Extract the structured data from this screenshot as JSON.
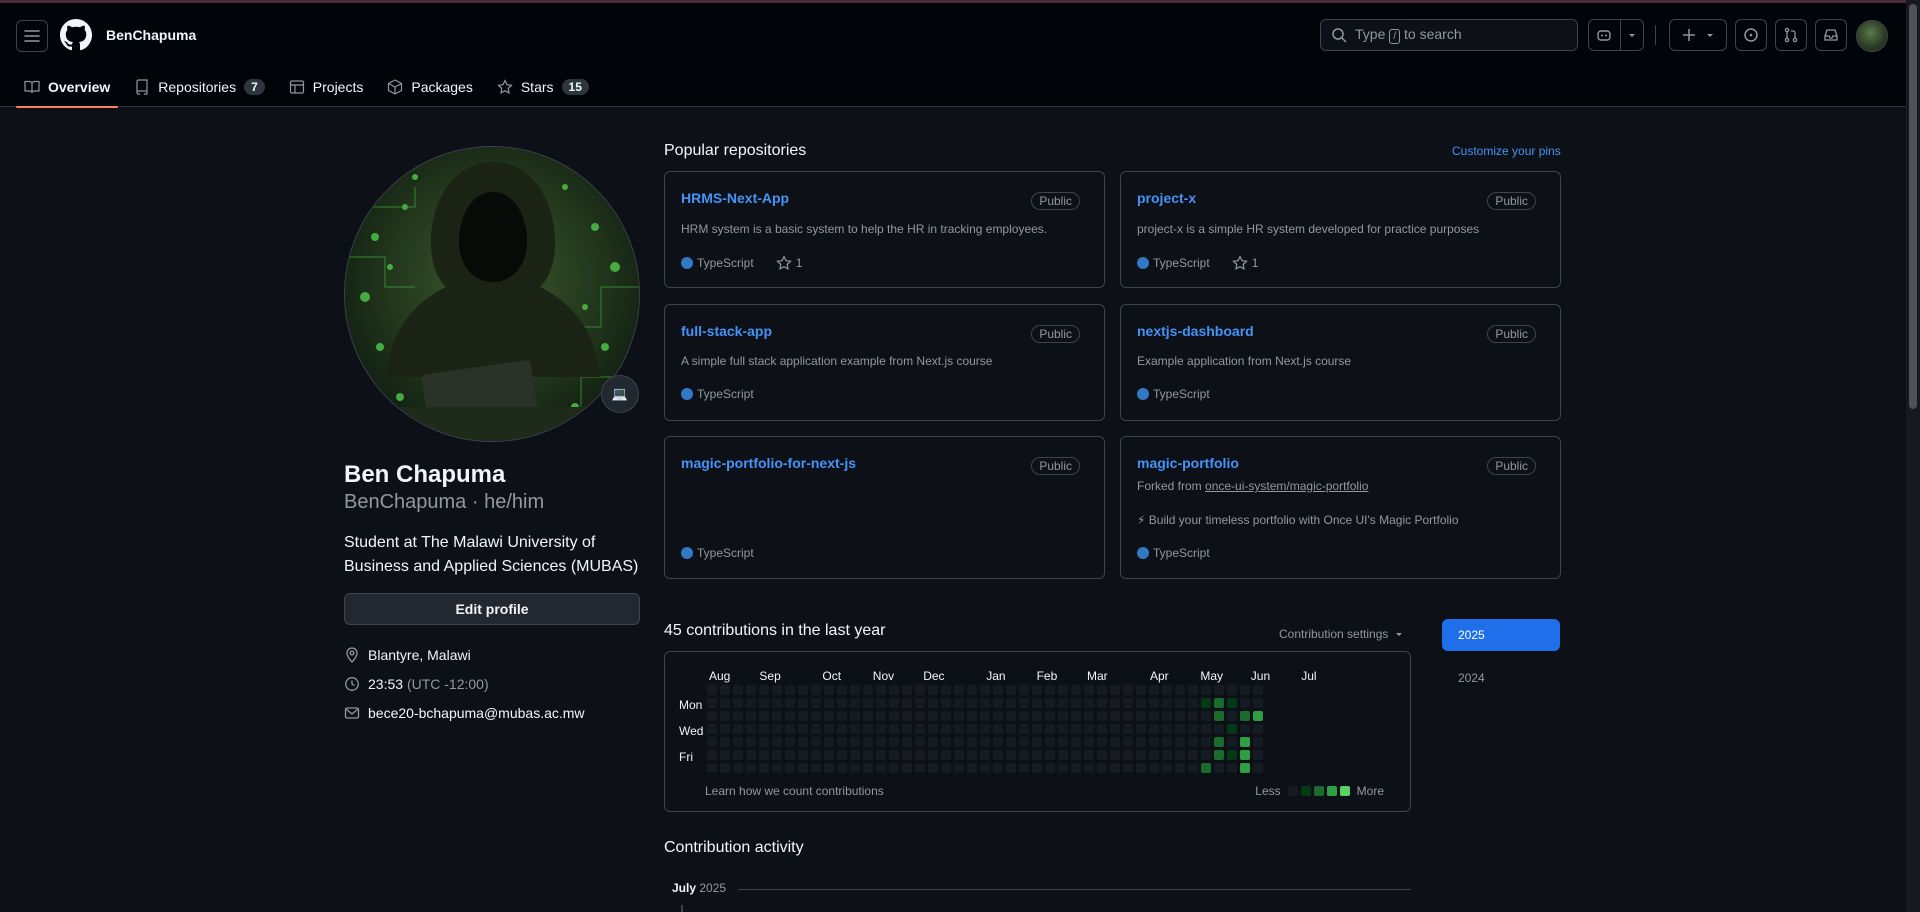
{
  "header": {
    "username": "BenChapuma",
    "search_placeholder_prefix": "Type",
    "search_key": "/",
    "search_placeholder_suffix": "to search"
  },
  "tabs": [
    {
      "label": "Overview",
      "count": null,
      "icon": "book-icon"
    },
    {
      "label": "Repositories",
      "count": "7",
      "icon": "repo-icon"
    },
    {
      "label": "Projects",
      "count": null,
      "icon": "table-icon"
    },
    {
      "label": "Packages",
      "count": null,
      "icon": "package-icon"
    },
    {
      "label": "Stars",
      "count": "15",
      "icon": "star-icon"
    }
  ],
  "profile": {
    "name": "Ben Chapuma",
    "login_line": "BenChapuma · he/him",
    "bio": "Student at The Malawi University of Business and Applied Sciences (MUBAS)",
    "edit_label": "Edit profile",
    "status_emoji": "💻",
    "location": "Blantyre, Malawi",
    "time": "23:53",
    "timezone": "(UTC -12:00)",
    "email": "bece20-bchapuma@mubas.ac.mw"
  },
  "popular": {
    "title": "Popular repositories",
    "customize": "Customize your pins",
    "repos": [
      {
        "name": "HRMS-Next-App",
        "visibility": "Public",
        "description": "HRM system is a basic system to help the HR in tracking employees.",
        "language": "TypeScript",
        "stars": "1"
      },
      {
        "name": "project-x",
        "visibility": "Public",
        "description": "project-x is a simple HR system developed for practice purposes",
        "language": "TypeScript",
        "stars": "1"
      },
      {
        "name": "full-stack-app",
        "visibility": "Public",
        "description": "A simple full stack application example from Next.js course",
        "language": "TypeScript",
        "stars": null
      },
      {
        "name": "nextjs-dashboard",
        "visibility": "Public",
        "description": "Example application from Next.js course",
        "language": "TypeScript",
        "stars": null
      },
      {
        "name": "magic-portfolio-for-next-js",
        "visibility": "Public",
        "description": "",
        "language": "TypeScript",
        "stars": null
      },
      {
        "name": "magic-portfolio",
        "visibility": "Public",
        "forked_prefix": "Forked from",
        "forked_from": "once-ui-system/magic-portfolio",
        "description": "⚡ Build your timeless portfolio with Once UI's Magic Portfolio",
        "language": "TypeScript",
        "stars": null
      }
    ]
  },
  "contributions": {
    "title": "45 contributions in the last year",
    "settings": "Contribution settings",
    "months": [
      "Aug",
      "Sep",
      "Oct",
      "Nov",
      "Dec",
      "Jan",
      "Feb",
      "Mar",
      "Apr",
      "May",
      "Jun",
      "Jul"
    ],
    "weekdays": [
      "Mon",
      "Wed",
      "Fri"
    ],
    "learn": "Learn how we count contributions",
    "less": "Less",
    "more": "More",
    "years": [
      "2025",
      "2024"
    ],
    "selected_year": "2025",
    "level_colors": [
      "#151b23",
      "#033a16",
      "#196c2e",
      "#2ea043",
      "#56d364"
    ],
    "active_cells": [
      {
        "week": 49,
        "day": 1,
        "level": 1
      },
      {
        "week": 49,
        "day": 6,
        "level": 2
      },
      {
        "week": 50,
        "day": 1,
        "level": 2
      },
      {
        "week": 50,
        "day": 2,
        "level": 2
      },
      {
        "week": 50,
        "day": 4,
        "level": 2
      },
      {
        "week": 50,
        "day": 5,
        "level": 2
      },
      {
        "week": 51,
        "day": 1,
        "level": 1
      },
      {
        "week": 51,
        "day": 3,
        "level": 1
      },
      {
        "week": 51,
        "day": 5,
        "level": 1
      },
      {
        "week": 52,
        "day": 2,
        "level": 2
      },
      {
        "week": 52,
        "day": 4,
        "level": 3
      },
      {
        "week": 52,
        "day": 5,
        "level": 3
      },
      {
        "week": 52,
        "day": 6,
        "level": 3
      },
      {
        "week": 53,
        "day": 2,
        "level": 3
      }
    ]
  },
  "activity": {
    "title": "Contribution activity",
    "month_bold": "July",
    "month_year": "2025"
  }
}
